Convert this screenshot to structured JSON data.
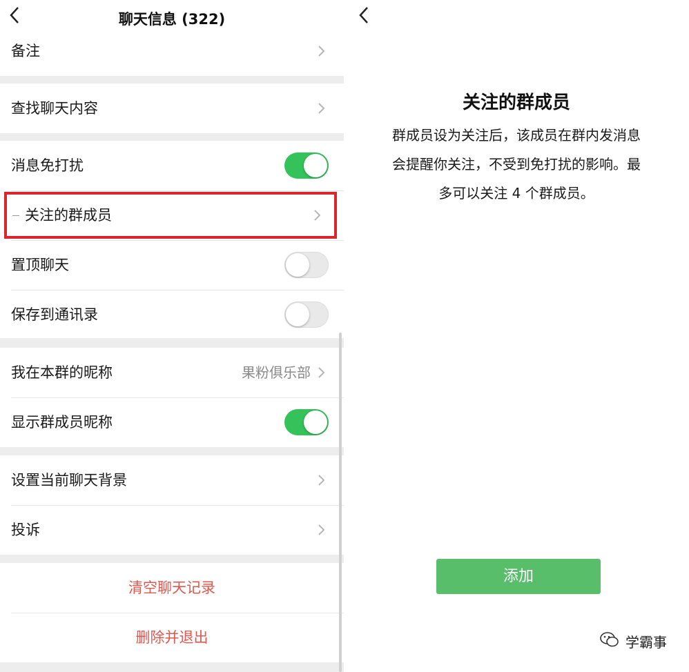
{
  "left": {
    "nav": {
      "title": "聊天信息 (322)",
      "back_icon": "chevron-left-icon"
    },
    "group1": {
      "remark": "备注"
    },
    "group2": {
      "search": "查找聊天内容"
    },
    "group3": {
      "mute": {
        "label": "消息免打扰",
        "on": true
      },
      "followed": {
        "label": "关注的群成员"
      },
      "pin": {
        "label": "置顶聊天",
        "on": false
      },
      "save": {
        "label": "保存到通讯录",
        "on": false
      }
    },
    "group4": {
      "nickname": {
        "label": "我在本群的昵称",
        "value": "果粉俱乐部"
      },
      "show_names": {
        "label": "显示群成员昵称",
        "on": true
      }
    },
    "group5": {
      "background": "设置当前聊天背景",
      "complaint": "投诉"
    },
    "group6": {
      "clear": "清空聊天记录",
      "delete": "删除并退出"
    }
  },
  "right": {
    "back_icon": "chevron-left-icon",
    "title": "关注的群成员",
    "desc_lines": [
      "群成员设为关注后，该成员在群内发消息",
      "会提醒你关注，不受到免打扰的影响。最",
      "多可以关注 4 个群成员。"
    ],
    "add_button": "添加",
    "watermark": "学霸事"
  },
  "colors": {
    "toggle_on": "#34c25a",
    "add_button": "#58be6a",
    "danger_text": "#e0574f",
    "highlight_border": "#d9262b"
  }
}
